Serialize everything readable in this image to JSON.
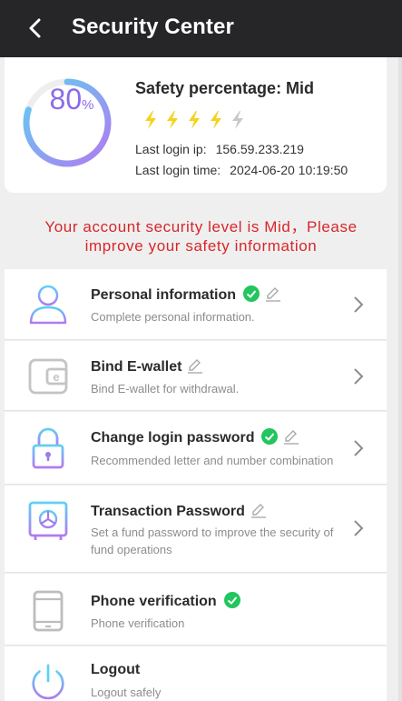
{
  "header": {
    "title": "Security Center",
    "back_icon": "chevron-left-icon"
  },
  "summary": {
    "score": "80",
    "score_unit": "%",
    "score_fraction": 0.8,
    "safety_label": "Safety percentage: Mid",
    "bolts_lit": 4,
    "bolts_total": 5,
    "last_login_ip_label": "Last login ip:",
    "last_login_ip": "156.59.233.219",
    "last_login_time_label": "Last login time:",
    "last_login_time": "2024-06-20 10:19:50"
  },
  "warning": {
    "line1": "Your account security level is Mid，Please",
    "line2": "improve your safety information"
  },
  "items": [
    {
      "name": "Personal information",
      "desc": "Complete personal information.",
      "verified": true,
      "editable": true,
      "icon": "user-icon"
    },
    {
      "name": "Bind E-wallet",
      "desc": "Bind E-wallet for withdrawal.",
      "verified": false,
      "editable": true,
      "icon": "wallet-icon"
    },
    {
      "name": "Change login password",
      "desc": "Recommended letter and number combination",
      "verified": true,
      "editable": true,
      "icon": "lock-icon"
    },
    {
      "name": "Transaction Password",
      "desc": "Set a fund password to improve the security of fund operations",
      "verified": false,
      "editable": true,
      "icon": "safe-icon"
    },
    {
      "name": "Phone verification",
      "desc": "Phone verification",
      "verified": true,
      "editable": false,
      "icon": "phone-icon"
    },
    {
      "name": "Logout",
      "desc": "Logout safely",
      "verified": false,
      "editable": false,
      "icon": "power-icon"
    }
  ],
  "colors": {
    "header_bg": "#262628",
    "warning": "#d8262a",
    "bolt_on": "#f5d21c",
    "bolt_off": "#c8c8c8",
    "check": "#22c55e",
    "gradient_start": "#5fd0f3",
    "gradient_end": "#b07bf0"
  }
}
